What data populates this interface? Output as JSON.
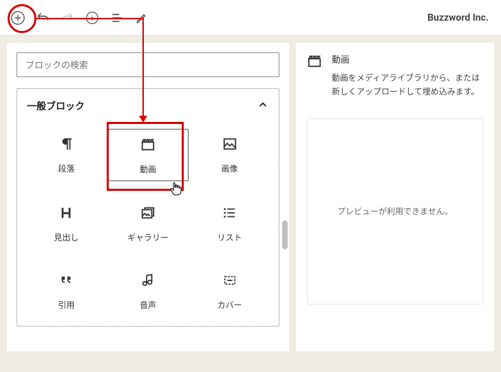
{
  "brand": "Buzzword Inc.",
  "search": {
    "placeholder": "ブロックの検索"
  },
  "category": {
    "title": "一般ブロック"
  },
  "blocks": [
    {
      "label": "段落"
    },
    {
      "label": "動画"
    },
    {
      "label": "画像"
    },
    {
      "label": "見出し"
    },
    {
      "label": "ギャラリー"
    },
    {
      "label": "リスト"
    },
    {
      "label": "引用"
    },
    {
      "label": "音声"
    },
    {
      "label": "カバー"
    }
  ],
  "info": {
    "title": "動画",
    "description": "動画をメディアライブラリから、または新しくアップロードして埋め込みます。"
  },
  "preview": {
    "message": "プレビューが利用できません。"
  }
}
